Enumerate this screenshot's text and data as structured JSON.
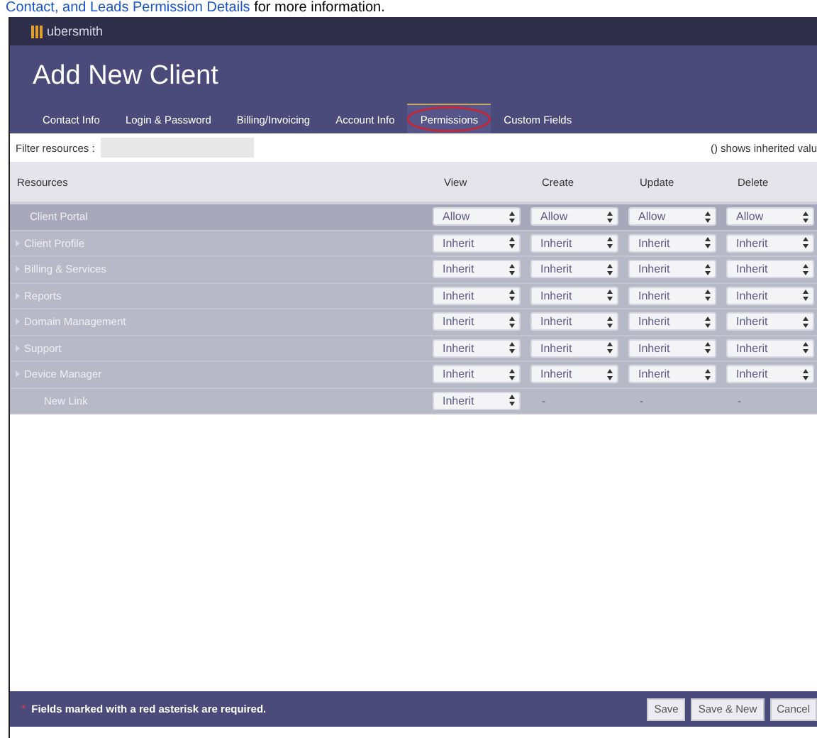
{
  "intro": {
    "link": "Contact, and Leads Permission Details",
    "text": " for more information."
  },
  "brand": "ubersmith",
  "title": "Add New Client",
  "tabs": [
    {
      "label": "Contact Info",
      "selected": false
    },
    {
      "label": "Login & Password",
      "selected": false
    },
    {
      "label": "Billing/Invoicing",
      "selected": false
    },
    {
      "label": "Account Info",
      "selected": false
    },
    {
      "label": "Permissions",
      "selected": true
    },
    {
      "label": "Custom Fields",
      "selected": false
    }
  ],
  "filter": {
    "label": "Filter resources :"
  },
  "legend": "() shows inherited valu",
  "table": {
    "resources_header": "Resources",
    "permission_columns": [
      "View",
      "Create",
      "Update",
      "Delete"
    ],
    "rows": [
      {
        "name": "Client Portal",
        "kind": "item",
        "highlighted": true,
        "cells": [
          {
            "kind": "select",
            "value": "Allow"
          },
          {
            "kind": "select",
            "value": "Allow"
          },
          {
            "kind": "select",
            "value": "Allow"
          },
          {
            "kind": "select",
            "value": "Allow"
          }
        ]
      },
      {
        "name": "Client Profile",
        "kind": "group",
        "highlighted": false,
        "cells": [
          {
            "kind": "select",
            "value": "Inherit"
          },
          {
            "kind": "select",
            "value": "Inherit"
          },
          {
            "kind": "select",
            "value": "Inherit"
          },
          {
            "kind": "select",
            "value": "Inherit"
          }
        ]
      },
      {
        "name": "Billing & Services",
        "kind": "group",
        "highlighted": false,
        "cells": [
          {
            "kind": "select",
            "value": "Inherit"
          },
          {
            "kind": "select",
            "value": "Inherit"
          },
          {
            "kind": "select",
            "value": "Inherit"
          },
          {
            "kind": "select",
            "value": "Inherit"
          }
        ]
      },
      {
        "name": "Reports",
        "kind": "group",
        "highlighted": false,
        "cells": [
          {
            "kind": "select",
            "value": "Inherit"
          },
          {
            "kind": "select",
            "value": "Inherit"
          },
          {
            "kind": "select",
            "value": "Inherit"
          },
          {
            "kind": "select",
            "value": "Inherit"
          }
        ]
      },
      {
        "name": "Domain Management",
        "kind": "group",
        "highlighted": false,
        "cells": [
          {
            "kind": "select",
            "value": "Inherit"
          },
          {
            "kind": "select",
            "value": "Inherit"
          },
          {
            "kind": "select",
            "value": "Inherit"
          },
          {
            "kind": "select",
            "value": "Inherit"
          }
        ]
      },
      {
        "name": "Support",
        "kind": "group",
        "highlighted": false,
        "cells": [
          {
            "kind": "select",
            "value": "Inherit"
          },
          {
            "kind": "select",
            "value": "Inherit"
          },
          {
            "kind": "select",
            "value": "Inherit"
          },
          {
            "kind": "select",
            "value": "Inherit"
          }
        ]
      },
      {
        "name": "Device Manager",
        "kind": "group",
        "highlighted": false,
        "cells": [
          {
            "kind": "select",
            "value": "Inherit"
          },
          {
            "kind": "select",
            "value": "Inherit"
          },
          {
            "kind": "select",
            "value": "Inherit"
          },
          {
            "kind": "select",
            "value": "Inherit"
          }
        ],
        "children": [
          {
            "name": "New Link",
            "kind": "item",
            "highlighted": false,
            "cells": [
              {
                "kind": "select",
                "value": "Inherit"
              },
              {
                "kind": "text",
                "text": "-"
              },
              {
                "kind": "text",
                "text": "-"
              },
              {
                "kind": "text",
                "text": "-"
              }
            ]
          }
        ]
      }
    ]
  },
  "footer": {
    "asterisk": "*",
    "note": "Fields marked with a red asterisk are required.",
    "buttons": [
      "Save",
      "Save & New",
      "Cancel"
    ]
  }
}
